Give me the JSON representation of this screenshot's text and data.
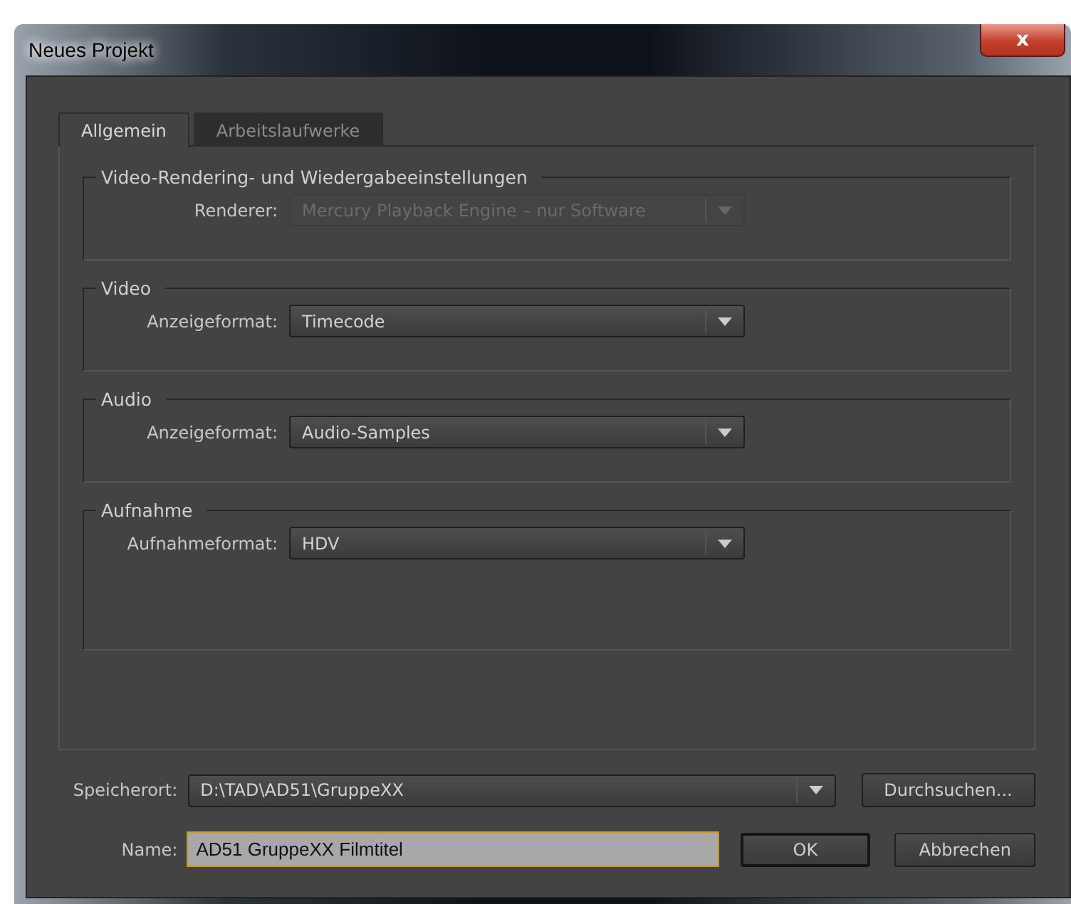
{
  "window": {
    "title": "Neues Projekt",
    "close": "x"
  },
  "tabs": [
    {
      "label": "Allgemein",
      "selected": true
    },
    {
      "label": "Arbeitslaufwerke",
      "selected": false
    }
  ],
  "groups": [
    {
      "title": "Video-Rendering- und Wiedergabeeinstellungen",
      "label": "Renderer:",
      "value": "Mercury Playback Engine – nur Software",
      "disabled": true,
      "tall": false
    },
    {
      "title": "Video",
      "label": "Anzeigeformat:",
      "value": "Timecode",
      "disabled": false,
      "tall": false
    },
    {
      "title": "Audio",
      "label": "Anzeigeformat:",
      "value": "Audio-Samples",
      "disabled": false,
      "tall": false
    },
    {
      "title": "Aufnahme",
      "label": "Aufnahmeformat:",
      "value": "HDV",
      "disabled": false,
      "tall": true
    }
  ],
  "location": {
    "label": "Speicherort:",
    "value": "D:\\TAD\\AD51\\GruppeXX",
    "browse": "Durchsuchen..."
  },
  "name": {
    "label": "Name:",
    "value": "AD51 GruppeXX Filmtitel"
  },
  "buttons": [
    {
      "label": "OK",
      "default": true
    },
    {
      "label": "Abbrechen",
      "default": false
    }
  ]
}
